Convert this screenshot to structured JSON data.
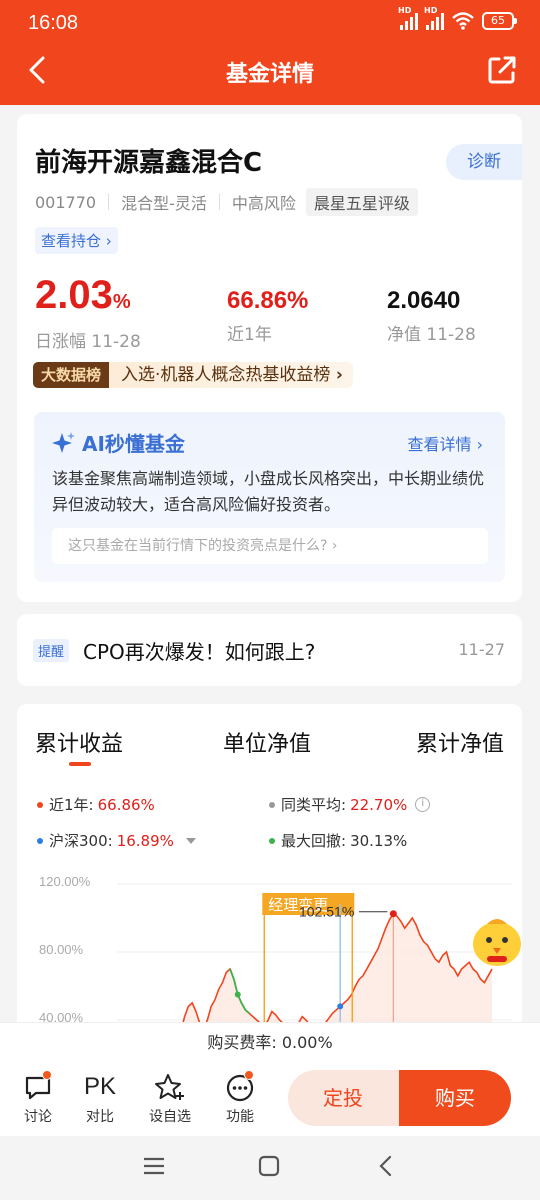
{
  "status": {
    "time": "16:08",
    "battery": "65"
  },
  "nav": {
    "title": "基金详情"
  },
  "fund": {
    "name": "前海开源嘉鑫混合C",
    "code": "001770",
    "type": "混合型-灵活",
    "risk": "中高风险",
    "rating": "晨星五星评级",
    "diagnose": "诊断",
    "holdings": "查看持仓"
  },
  "stats": {
    "daily_value": "2.03",
    "daily_unit": "%",
    "daily_label": "日涨幅 11-28",
    "year_value": "66.86%",
    "year_label": "近1年",
    "nav_value": "2.0640",
    "nav_label": "净值 11-28"
  },
  "rank": {
    "tag": "大数据榜",
    "text": "入选·机器人概念热基收益榜"
  },
  "ai": {
    "title": "AI秒懂基金",
    "more": "查看详情",
    "summary": "该基金聚焦高端制造领域，小盘成长风格突出，中长期业绩优异但波动较大，适合高风险偏好投资者。",
    "ask": "这只基金在当前行情下的投资亮点是什么?"
  },
  "reminder": {
    "tag": "提醒",
    "text": "CPO再次爆发！如何跟上?",
    "date": "11-27"
  },
  "tabs": [
    "累计收益",
    "单位净值",
    "累计净值"
  ],
  "legend": {
    "fund_label": "近1年:",
    "fund_value": "66.86%",
    "avg_label": "同类平均:",
    "avg_value": "22.70%",
    "index_label": "沪深300:",
    "index_value": "16.89%",
    "drawdown_label": "最大回撤:",
    "drawdown_value": "30.13%"
  },
  "chart_data": {
    "type": "line",
    "y_ticks": [
      "120.00%",
      "80.00%",
      "40.00%"
    ],
    "ylim": [
      40,
      120
    ],
    "annotation_event": "经理变更",
    "annotation_peak": "102.51%",
    "series": [
      {
        "name": "近1年",
        "color": "#f0451d",
        "values": [
          28,
          33,
          42,
          48,
          50,
          45,
          38,
          35,
          40,
          48,
          52,
          58,
          62,
          68,
          70,
          64,
          55,
          50,
          46,
          44,
          42,
          40,
          38,
          36,
          40,
          45,
          43,
          40,
          38,
          36,
          35,
          34,
          38,
          42,
          40,
          37,
          35,
          34,
          36,
          38,
          41,
          44,
          46,
          48,
          50,
          52,
          55,
          60,
          64,
          66,
          70,
          74,
          78,
          82,
          88,
          94,
          99,
          102.51,
          101,
          98,
          94,
          97,
          100,
          96,
          90,
          86,
          84,
          80,
          76,
          74,
          78,
          80,
          72,
          70,
          66,
          70,
          72,
          74,
          70,
          68,
          64,
          62,
          66,
          70
        ]
      }
    ]
  },
  "fee": {
    "label": "购买费率:",
    "value": "0.00%"
  },
  "bottom": {
    "discuss": "讨论",
    "compare_icon": "PK",
    "compare": "对比",
    "watch": "设自选",
    "func": "功能",
    "fixed": "定投",
    "buy": "购买"
  }
}
